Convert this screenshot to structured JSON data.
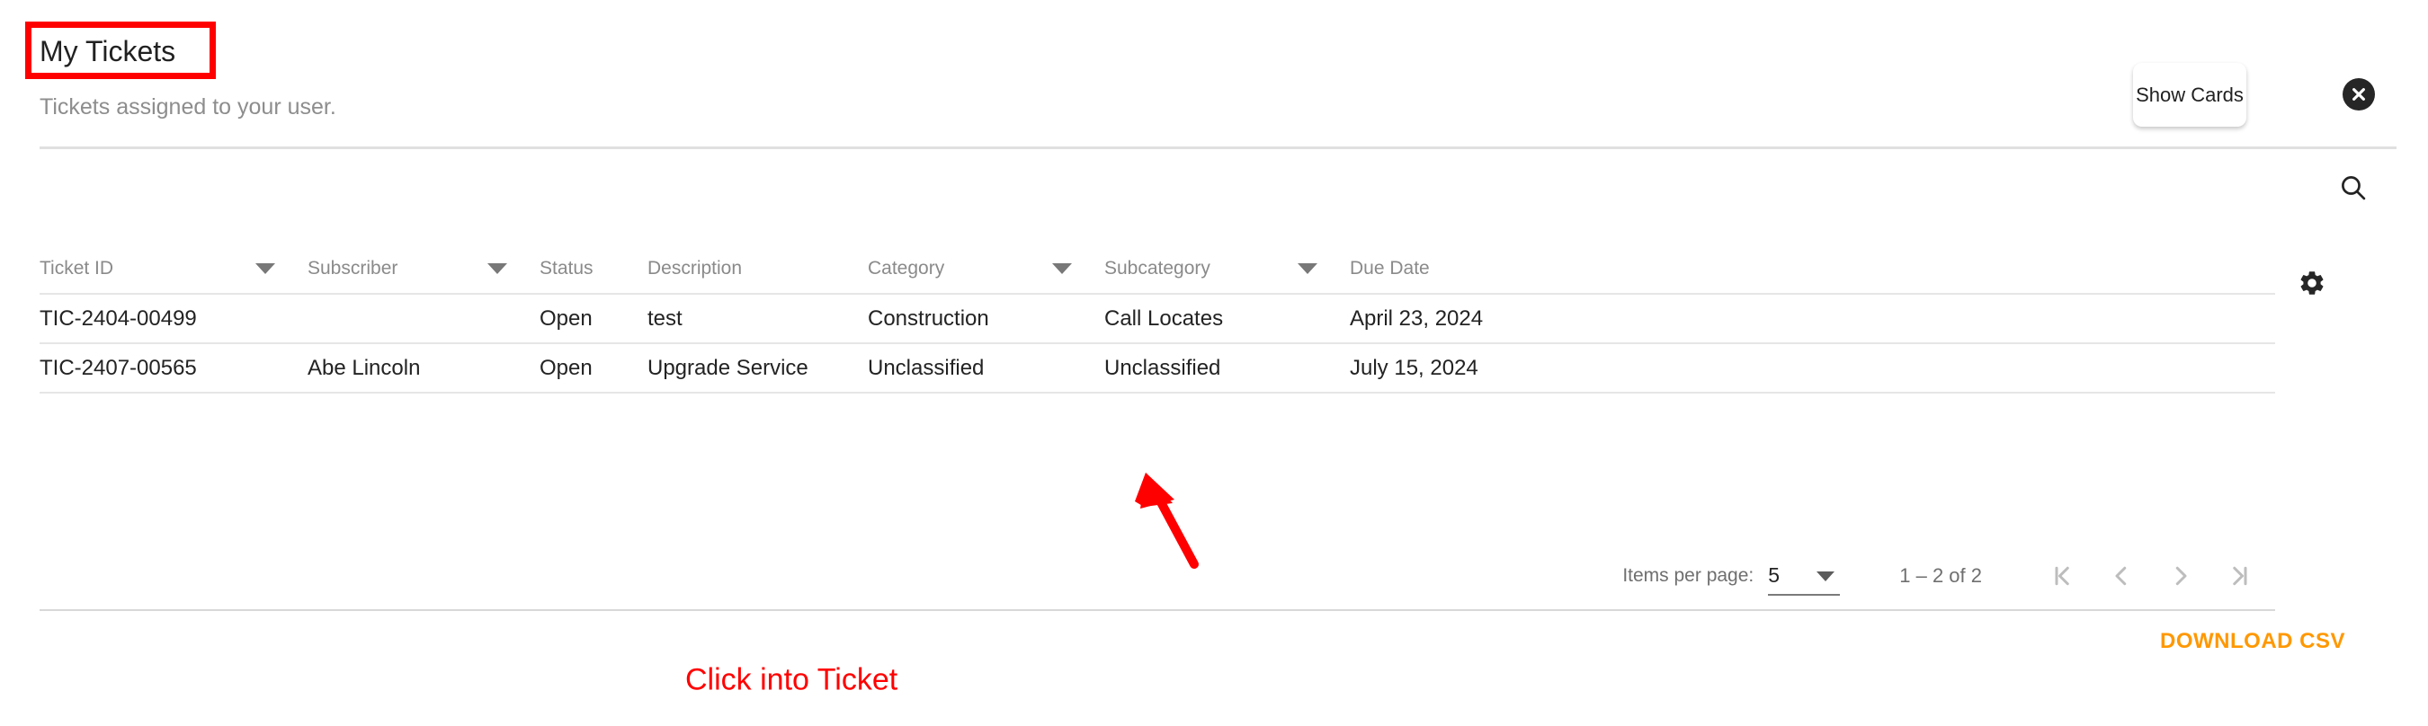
{
  "header": {
    "title": "My Tickets",
    "subtitle": "Tickets assigned to your user.",
    "show_cards_label": "Show Cards",
    "close_icon": "close-circle-icon",
    "search_icon": "search-icon",
    "settings_icon": "gear-icon"
  },
  "table": {
    "columns": [
      {
        "label": "Ticket ID",
        "filterable": true
      },
      {
        "label": "Subscriber",
        "filterable": true
      },
      {
        "label": "Status",
        "filterable": false
      },
      {
        "label": "Description",
        "filterable": false
      },
      {
        "label": "Category",
        "filterable": true
      },
      {
        "label": "Subcategory",
        "filterable": true
      },
      {
        "label": "Due Date",
        "filterable": false
      }
    ],
    "rows": [
      {
        "ticket_id": "TIC-2404-00499",
        "subscriber": "",
        "status": "Open",
        "description": "test",
        "category": "Construction",
        "subcategory": "Call Locates",
        "due_date": "April 23, 2024"
      },
      {
        "ticket_id": "TIC-2407-00565",
        "subscriber": "Abe Lincoln",
        "status": "Open",
        "description": "Upgrade Service",
        "category": "Unclassified",
        "subcategory": "Unclassified",
        "due_date": "July 15, 2024"
      }
    ]
  },
  "paginator": {
    "items_per_page_label": "Items per page:",
    "items_per_page_value": "5",
    "range_label": "1 – 2 of 2",
    "first_page_icon": "first-page-icon",
    "prev_page_icon": "chevron-left-icon",
    "next_page_icon": "chevron-right-icon",
    "last_page_icon": "last-page-icon"
  },
  "footer": {
    "download_csv_label": "DOWNLOAD CSV"
  },
  "annotation": {
    "text": "Click into Ticket",
    "color": "#ff0000",
    "highlight_target": "My Tickets"
  },
  "colors": {
    "accent_orange": "#ff9800",
    "annotation_red": "#ff0000",
    "text_primary": "#232323",
    "text_muted": "#8a8a8a",
    "divider": "#e0e0e0",
    "close_button_bg": "#262626"
  }
}
